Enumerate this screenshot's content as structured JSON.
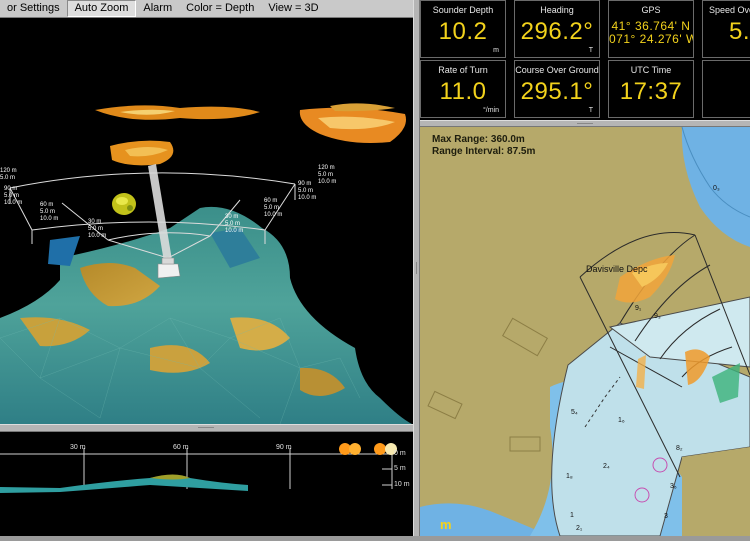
{
  "menu": {
    "items": [
      "or Settings",
      "Auto Zoom",
      "Alarm",
      "Color = Depth",
      "View = 3D"
    ],
    "active_index": 1
  },
  "view3d": {
    "ring_labels": [
      [
        "120 m",
        "5.0 m",
        "10.0 m"
      ],
      [
        "90 m",
        "5.0 m",
        "10.0 m"
      ],
      [
        "60 m",
        "5.0 m",
        "10.0 m"
      ],
      [
        "30 m",
        "5.0 m",
        "10.0 m"
      ],
      [
        "30 m",
        "5.0 m",
        "10.0 m"
      ],
      [
        "60 m",
        "5.0 m",
        "10.0 m"
      ],
      [
        "90 m",
        "5.0 m",
        "10.0 m"
      ],
      [
        "120 m",
        "5.0 m"
      ]
    ]
  },
  "profile": {
    "range_labels": [
      "30 m",
      "60 m",
      "90 m"
    ],
    "depth_labels": [
      "0 m",
      "5 m",
      "10 m"
    ]
  },
  "instruments": [
    {
      "label": "Sounder Depth",
      "value": "10.2",
      "unit": "m"
    },
    {
      "label": "Heading",
      "value": "296.2°",
      "unit": "T"
    },
    {
      "label": "GPS",
      "value_lines": [
        "41° 36.764' N",
        "071° 24.276' W"
      ]
    },
    {
      "label": "Speed Over",
      "value": "5.",
      "unit": ""
    },
    {
      "label": "Rate of Turn",
      "value": "11.0",
      "unit": "°/min"
    },
    {
      "label": "Course Over Ground",
      "value": "295.1°",
      "unit": "T"
    },
    {
      "label": "UTC Time",
      "value": "17:37",
      "unit": ""
    }
  ],
  "chart": {
    "max_range": "Max Range: 360.0m",
    "range_interval": "Range Interval: 87.5m",
    "place_name": "Davisville Depc",
    "logo": "m",
    "depth_soundings": [
      "0₃",
      "9₁",
      "9₃",
      "1₆",
      "2₄",
      "8₂",
      "1₈",
      "3₆",
      "3",
      "2₁",
      "5₄",
      "1"
    ]
  },
  "colors": {
    "land": "#b6a96a",
    "water_shallow": "#bfe0ea",
    "water_deep": "#6fb2e4",
    "instrument_value": "#f2d21c",
    "sonar_cone": "#c9e8ee"
  }
}
